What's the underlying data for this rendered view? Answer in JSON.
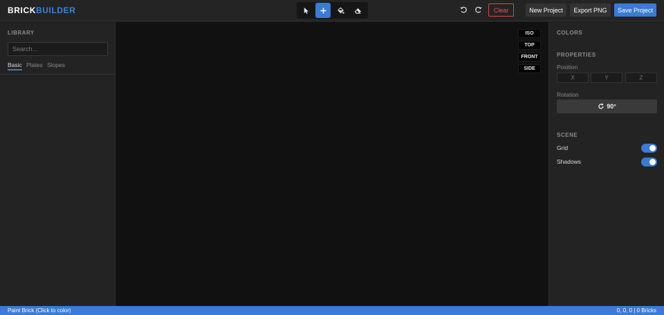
{
  "header": {
    "logo_part1": "BRICK",
    "logo_part2": "BUILDER",
    "tools": [
      {
        "name": "select",
        "active": false
      },
      {
        "name": "add",
        "active": true
      },
      {
        "name": "paint",
        "active": false
      },
      {
        "name": "erase",
        "active": false
      }
    ],
    "clear_label": "Clear",
    "new_project_label": "New Project",
    "export_png_label": "Export PNG",
    "save_project_label": "Save Project"
  },
  "library": {
    "title": "LIBRARY",
    "search_placeholder": "Search...",
    "tabs": [
      {
        "label": "Basic",
        "active": true
      },
      {
        "label": "Plates",
        "active": false
      },
      {
        "label": "Slopes",
        "active": false
      }
    ]
  },
  "viewport": {
    "view_buttons": [
      "ISO",
      "TOP",
      "FRONT",
      "SIDE"
    ]
  },
  "panel": {
    "colors_title": "COLORS",
    "properties_title": "PROPERTIES",
    "position_label": "Position",
    "position_placeholders": [
      "X",
      "Y",
      "Z"
    ],
    "rotation_label": "Rotation",
    "rotation_value": "90°",
    "scene_title": "SCENE",
    "grid_label": "Grid",
    "grid_on": true,
    "shadows_label": "Shadows",
    "shadows_on": true
  },
  "status": {
    "mode_text": "Paint Brick (Click to color)",
    "info_text": "0, 0, 0 | 0 Bricks"
  },
  "colors": {
    "accent": "#3a7bd5",
    "danger": "#e04545"
  }
}
